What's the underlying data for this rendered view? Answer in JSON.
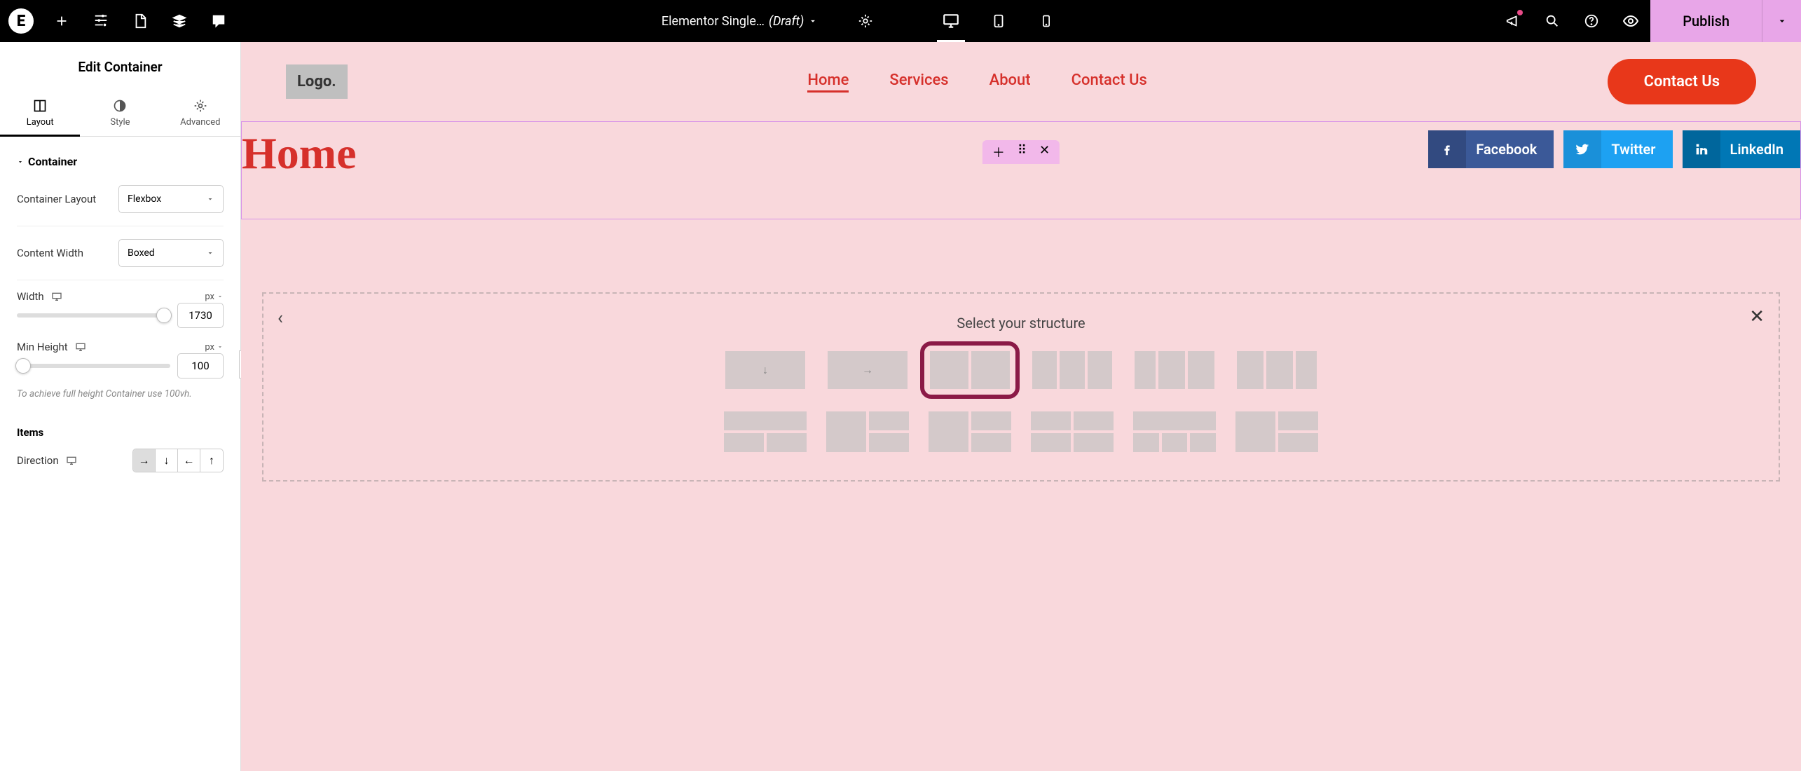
{
  "topbar": {
    "doc_name": "Elementor Single…",
    "draft_label": "(Draft)",
    "publish_label": "Publish"
  },
  "sidebar": {
    "title": "Edit Container",
    "tabs": {
      "layout": "Layout",
      "style": "Style",
      "advanced": "Advanced"
    },
    "section": "Container",
    "container_layout_label": "Container Layout",
    "container_layout_value": "Flexbox",
    "content_width_label": "Content Width",
    "content_width_value": "Boxed",
    "width_label": "Width",
    "width_unit": "px",
    "width_value": "1730",
    "min_height_label": "Min Height",
    "min_height_unit": "px",
    "min_height_value": "100",
    "hint": "To achieve full height Container use 100vh.",
    "items_label": "Items",
    "direction_label": "Direction"
  },
  "canvas": {
    "logo": "Logo.",
    "nav": {
      "home": "Home",
      "services": "Services",
      "about": "About",
      "contact": "Contact Us"
    },
    "cta": "Contact Us",
    "page_title": "Home",
    "social": {
      "facebook": "Facebook",
      "twitter": "Twitter",
      "linkedin": "LinkedIn"
    },
    "structure_title": "Select your structure"
  }
}
